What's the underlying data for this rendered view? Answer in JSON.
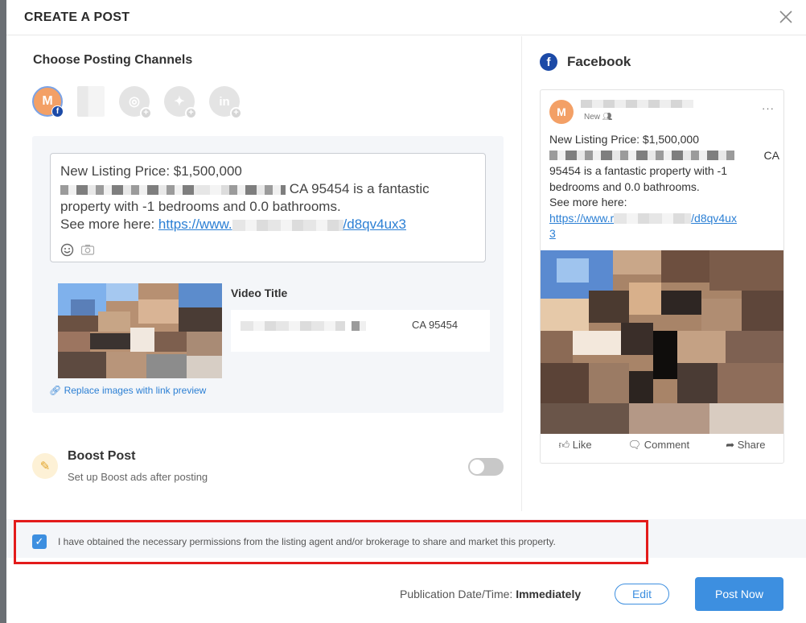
{
  "modal": {
    "title": "CREATE A POST"
  },
  "channels": {
    "section_title": "Choose Posting Channels",
    "avatar_initial": "M"
  },
  "editor": {
    "line1": "New Listing Price: $1,500,000",
    "line2_tail": "CA 95454 is a fantastic",
    "line3": "property with -1 bedrooms and 0.0 bathrooms.",
    "see_more": "See more here: ",
    "link_start": "https://www.",
    "link_end": "/d8qv4ux3"
  },
  "video": {
    "title_label": "Video Title",
    "location": "CA 95454",
    "replace_link": "Replace images with link preview"
  },
  "boost": {
    "title": "Boost Post",
    "subtitle": "Set up Boost ads after posting",
    "enabled": false
  },
  "preview": {
    "network": "Facebook",
    "avatar_initial": "M",
    "meta": "New",
    "line1": "New Listing Price: $1,500,000",
    "line2_tail": "CA",
    "line3": "95454 is a fantastic property with -1",
    "line4": "bedrooms and 0.0 bathrooms.",
    "line5": "See more here:",
    "link_start": "https://www.r",
    "link_end": "/d8qv4ux",
    "link_wrap": "3",
    "actions": {
      "like": "Like",
      "comment": "Comment",
      "share": "Share"
    }
  },
  "permission": {
    "checked": true,
    "text": "I have obtained the necessary permissions from the listing agent and/or brokerage to share and market this property."
  },
  "footer": {
    "pub_label": "Publication Date/Time: ",
    "pub_value": "Immediately",
    "edit_label": "Edit",
    "post_label": "Post Now"
  },
  "colors": {
    "accent": "#3d8fe0",
    "facebook": "#1c4aa7",
    "highlight": "#e31b1b"
  }
}
